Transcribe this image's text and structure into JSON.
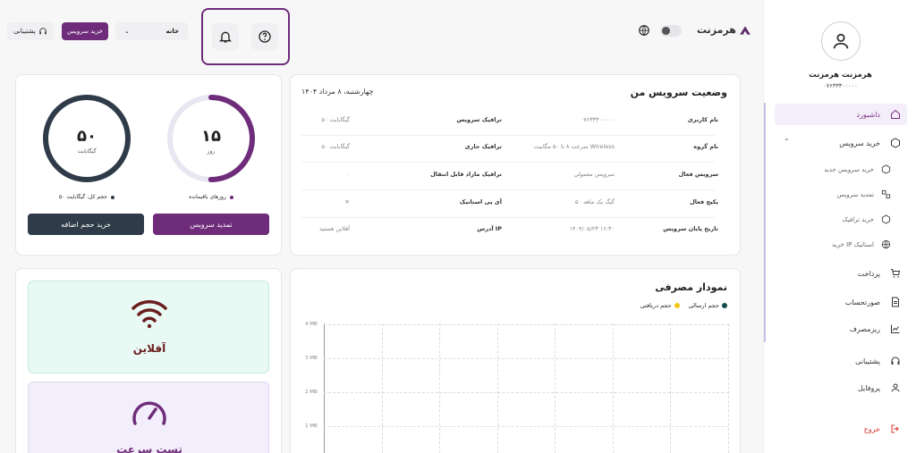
{
  "brand": {
    "name": "هرمزنت"
  },
  "user": {
    "name": "هرمزنت هرمزنت",
    "phone": "۰۷۶۳۳۳۰۰۰۰۰"
  },
  "sidebar": {
    "items": [
      {
        "label": "داشبورد"
      },
      {
        "label": "خرید سرویس"
      },
      {
        "label": "پرداخت"
      },
      {
        "label": "صورتحساب"
      },
      {
        "label": "ریزمصرف"
      },
      {
        "label": "پشتیبانی"
      },
      {
        "label": "پروفایل"
      },
      {
        "label": "خروج"
      }
    ],
    "sub_items": [
      {
        "label": "خرید سرویس جدید"
      },
      {
        "label": "تمدید سرویس"
      },
      {
        "label": "خرید ترافیک"
      },
      {
        "label": "خرید IP استاتیک"
      }
    ]
  },
  "topbar": {
    "support_label": "پشتیبانی",
    "buy_label": "خرید سرویس",
    "home_select": "خانه"
  },
  "status": {
    "title": "وضعیت سرویس من",
    "date": "چهارشنبه، ۸ مرداد ۱۴۰۴",
    "rows": [
      {
        "l1": "نام کاربری",
        "v1": "۰۷۶۳۳۳۰۰۰۰۰",
        "l2": "ترافیک سرویس",
        "v2": "۵۰ گیگابایت"
      },
      {
        "l1": "نام گروه",
        "v1": "سرعت ۸ تا ۵۰ مگابیت Wireless",
        "l2": "ترافیک جاری",
        "v2": "۵۰ گیگابایت"
      },
      {
        "l1": "سرویس فعال",
        "v1": "سرویس معمولی",
        "l2": "ترافیک مازاد قابل انتقال",
        "v2": "۰"
      },
      {
        "l1": "پکیج فعال",
        "v1": "۵۰ گیگ یک ماهه",
        "l2": "آی پی استاتیک",
        "v2": "✕"
      },
      {
        "l1": "تاریخ پایان سرویس",
        "v1": "۱۴۰۴/۰۵/۲۳ ۱۶:۳۰",
        "l2": "آدرس IP",
        "v2": "آفلاین هستید"
      }
    ]
  },
  "summary": {
    "days_value": "۱۵",
    "days_unit": "روز",
    "days_label": "روزهای باقیمانده",
    "days_fraction": 0.5,
    "volume_value": "۵۰",
    "volume_unit": "گیگابایت",
    "volume_label": "حجم کل: گیگابایت ۵۰",
    "volume_fraction": 1.0,
    "renew_button": "تمدید سرویس",
    "add_volume_button": "خرید حجم اضافه"
  },
  "tiles": {
    "offline_label": "آفلاین",
    "speedtest_label": "تست سرعت"
  },
  "chart_data": {
    "type": "line",
    "title": "نمودار مصرفی",
    "series": [
      {
        "name": "حجم ارسالی",
        "color": "#0f4c4c",
        "values": []
      },
      {
        "name": "حجم دریافتی",
        "color": "#f5c518",
        "values": []
      }
    ],
    "y_ticks": [
      "4 MB",
      "3 MB",
      "2 MB",
      "1 MB"
    ],
    "grid": true
  },
  "colors": {
    "accent": "#6e2c7a",
    "dark": "#2f3b48",
    "offline_bg": "#e9faf5",
    "speed_bg": "#f3eefb"
  }
}
